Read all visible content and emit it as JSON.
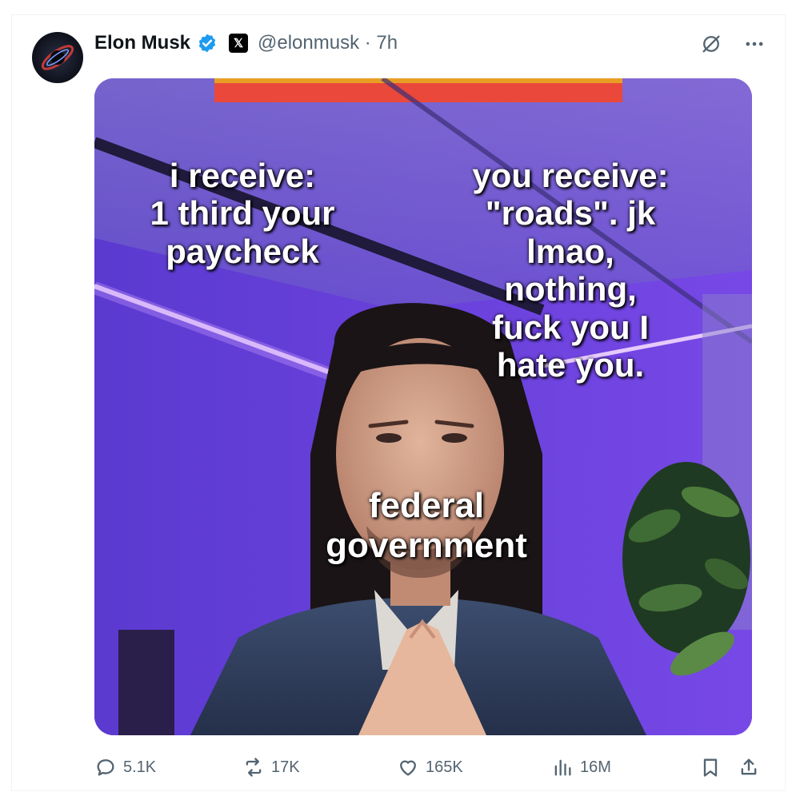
{
  "tweet": {
    "author_name": "Elon Musk",
    "handle": "@elonmusk",
    "time": "· 7h",
    "x_logo": "𝕏"
  },
  "meme": {
    "top_left": [
      "i receive:",
      "1 third your",
      "paycheck"
    ],
    "top_right": [
      "you receive:",
      "\"roads\". jk",
      "lmao,",
      "nothing,",
      "fuck you I",
      "hate you."
    ],
    "center": [
      "federal",
      "government"
    ]
  },
  "actions": {
    "replies": "5.1K",
    "reposts": "17K",
    "likes": "165K",
    "views": "16M"
  },
  "icons": {
    "reply": "speech-bubble-icon",
    "repost": "repost-icon",
    "like": "heart-icon",
    "views": "bar-chart-icon",
    "bookmark": "bookmark-icon",
    "share": "share-icon",
    "grok": "grok-icon",
    "more": "more-icon"
  },
  "colors": {
    "verified": "#1d9bf0",
    "secondary_text": "#536471",
    "meme_purple": "#6238ce"
  }
}
